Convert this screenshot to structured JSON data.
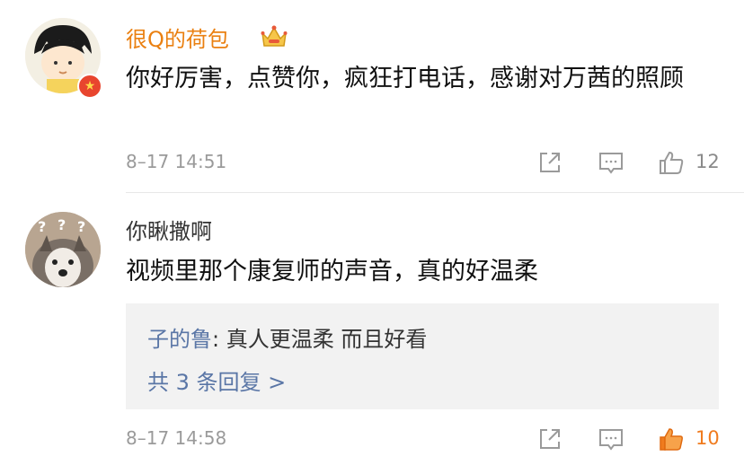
{
  "comments": [
    {
      "username": "很Q的荷包",
      "text": "你好厉害，点赞你，疯狂打电话，感谢对万茜的照顾",
      "time": "8–17 14:51",
      "likes": "12"
    },
    {
      "username": "你瞅撒啊",
      "text": "视频里那个康复师的声音，真的好温柔",
      "reply_preview": {
        "user": "子的鲁",
        "text": ": 真人更温柔 而且好看"
      },
      "reply_more": "共 3 条回复 >",
      "time": "8–17 14:58",
      "likes": "10",
      "liked": true
    }
  ],
  "colors": {
    "vip_name": "#ea8011",
    "link_blue": "#5a76a6",
    "liked_orange": "#f07b1e"
  },
  "icons": [
    "crown-icon",
    "verified-badge-icon",
    "share-icon",
    "comment-icon",
    "thumbs-up-icon",
    "question-mark-icon"
  ]
}
